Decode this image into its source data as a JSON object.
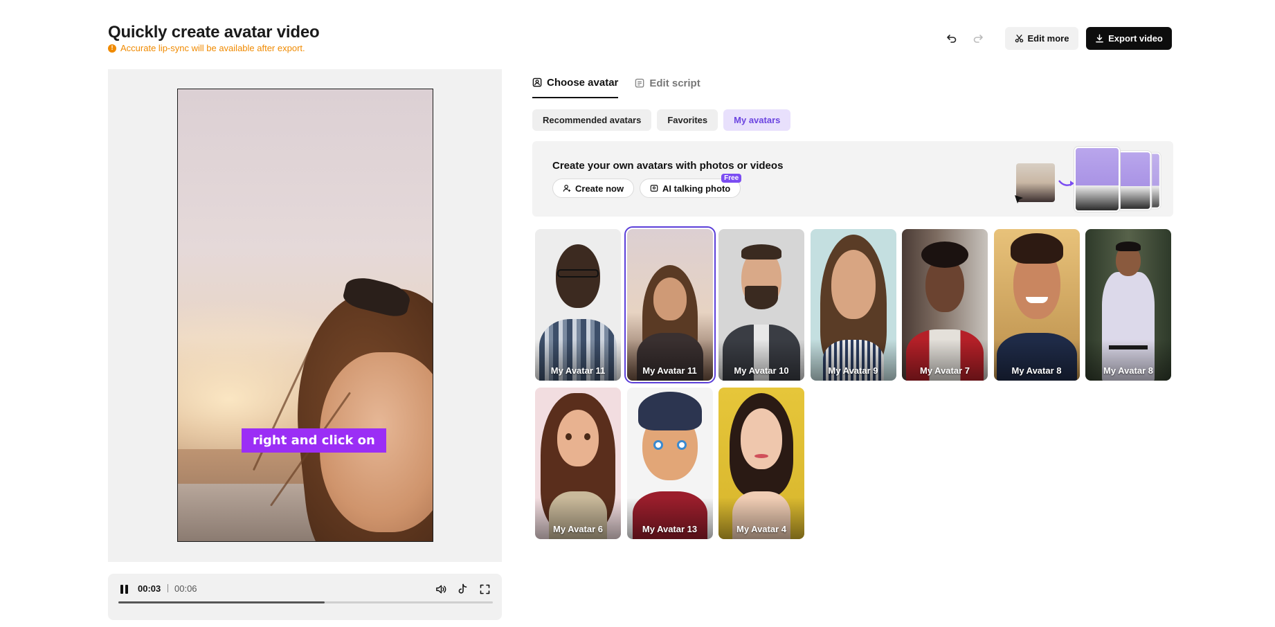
{
  "header": {
    "title": "Quickly create avatar video",
    "notice": "Accurate lip-sync will be available after export.",
    "edit_more_label": "Edit more",
    "export_label": "Export video"
  },
  "preview": {
    "caption": "right and click on"
  },
  "player": {
    "current_time": "00:03",
    "total_time": "00:06",
    "progress": 0.55
  },
  "tabs": [
    {
      "label": "Choose avatar",
      "active": true,
      "icon": "avatar-select-icon"
    },
    {
      "label": "Edit script",
      "active": false,
      "icon": "script-icon"
    }
  ],
  "subtabs": [
    {
      "label": "Recommended avatars",
      "active": false
    },
    {
      "label": "Favorites",
      "active": false
    },
    {
      "label": "My avatars",
      "active": true
    }
  ],
  "promo": {
    "title": "Create your own avatars with photos or videos",
    "create_now_label": "Create now",
    "talking_photo_label": "AI talking photo",
    "free_badge": "Free"
  },
  "avatars": [
    {
      "label": "My Avatar 11",
      "selected": false
    },
    {
      "label": "My Avatar 11",
      "selected": true
    },
    {
      "label": "My Avatar 10",
      "selected": false
    },
    {
      "label": "My Avatar 9",
      "selected": false
    },
    {
      "label": "My Avatar 7",
      "selected": false
    },
    {
      "label": "My Avatar 8",
      "selected": false
    },
    {
      "label": "My Avatar 8",
      "selected": false
    },
    {
      "label": "My Avatar 6",
      "selected": false
    },
    {
      "label": "My Avatar 13",
      "selected": false
    },
    {
      "label": "My Avatar 4",
      "selected": false
    }
  ],
  "colors": {
    "accent_purple": "#7b4df2",
    "caption_purple": "#9b2ef5",
    "notice_orange": "#f08a00",
    "export_bg": "#0d0d0d"
  }
}
